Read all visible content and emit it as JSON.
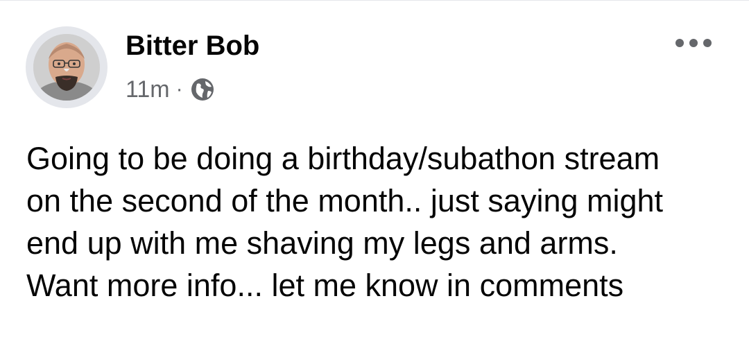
{
  "post": {
    "author": {
      "name": "Bitter Bob",
      "avatar_icon": "profile-photo"
    },
    "timestamp": "11m",
    "separator": "·",
    "audience_icon": "globe-icon",
    "more_icon": "more-horizontal-icon",
    "text_lines": [
      "Going to be doing a birthday/subathon stream",
      "on the second of the month.. just saying might",
      "end up with me shaving my legs and arms.",
      "Want more info... let me know in comments"
    ]
  },
  "colors": {
    "name_text": "#050505",
    "meta_text": "#65676b",
    "icon_gray": "#65676b",
    "avatar_ring": "#e4e6eb",
    "background": "#ffffff"
  }
}
